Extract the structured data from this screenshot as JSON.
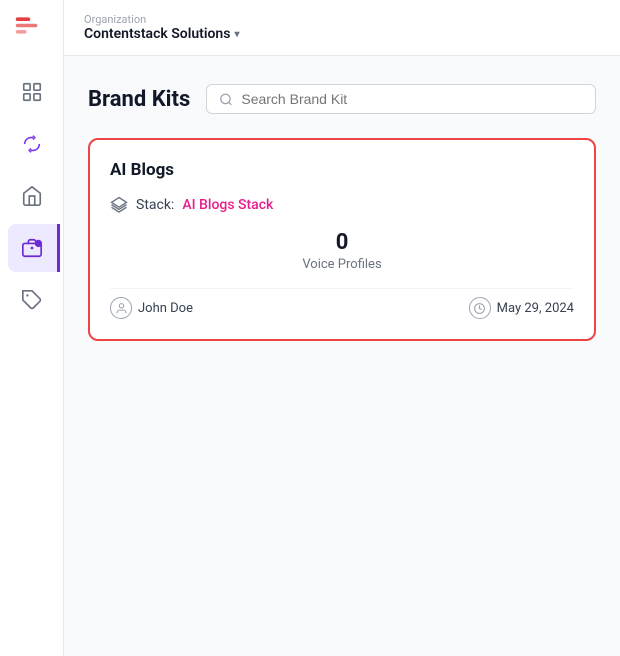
{
  "organization": {
    "label": "Organization",
    "name": "Contentstack Solutions"
  },
  "page": {
    "title": "Brand Kits",
    "search_placeholder": "Search Brand Kit"
  },
  "sidebar": {
    "items": [
      {
        "id": "grid",
        "label": "Dashboard",
        "active": false
      },
      {
        "id": "loop",
        "label": "Loop",
        "active": false
      },
      {
        "id": "marketplace",
        "label": "Marketplace",
        "active": false
      },
      {
        "id": "brand-kit",
        "label": "Brand Kit",
        "active": true
      },
      {
        "id": "extensions",
        "label": "Extensions",
        "active": false
      }
    ]
  },
  "brand_kits": [
    {
      "id": "ai-blogs",
      "title": "AI Blogs",
      "stack_label": "Stack:",
      "stack_name": "AI Blogs Stack",
      "voice_profiles_count": "0",
      "voice_profiles_label": "Voice Profiles",
      "author": "John Doe",
      "date": "May 29, 2024"
    }
  ]
}
